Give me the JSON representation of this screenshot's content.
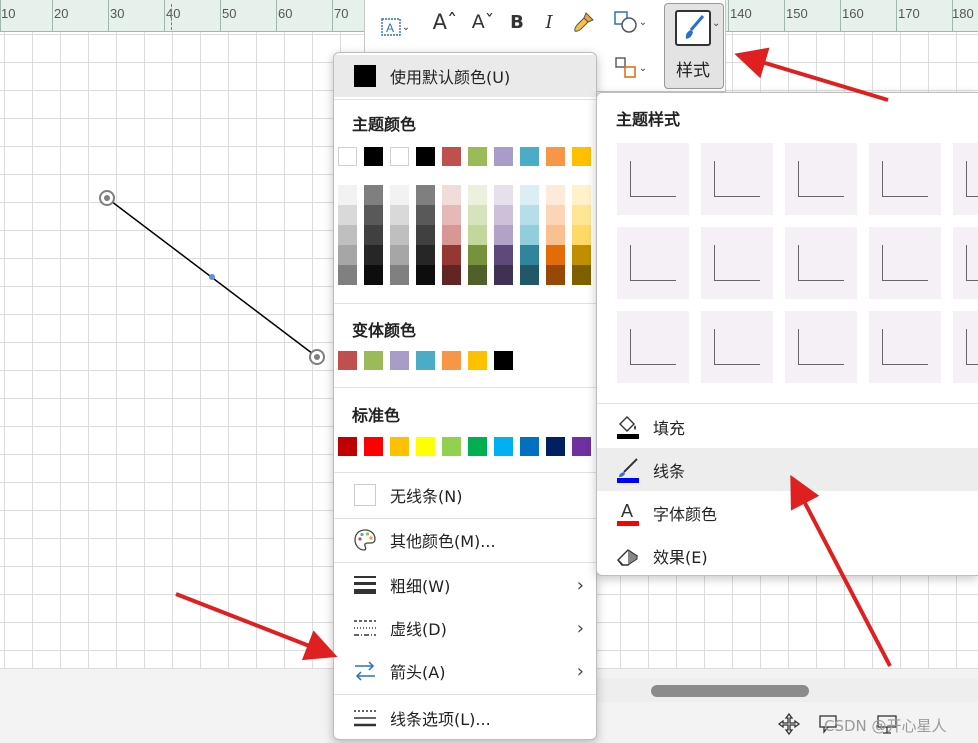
{
  "ruler": {
    "labels": [
      "10",
      "20",
      "30",
      "40",
      "50",
      "60",
      "70",
      "140",
      "150",
      "160",
      "170",
      "180"
    ]
  },
  "toolbar": {
    "style_label": "样式"
  },
  "color_menu": {
    "default_color_label": "使用默认颜色(U)",
    "theme_colors_title": "主题颜色",
    "theme_colors_top": [
      "#ffffff",
      "#000000",
      "#ffffff",
      "#000000",
      "#c0504d",
      "#9bbb59",
      "#a89cc8",
      "#4bacc6",
      "#f79646",
      "#ffc000"
    ],
    "theme_colors_shades": [
      [
        "#f2f2f2",
        "#d9d9d9",
        "#bfbfbf",
        "#a6a6a6",
        "#808080"
      ],
      [
        "#7f7f7f",
        "#595959",
        "#404040",
        "#262626",
        "#0d0d0d"
      ],
      [
        "#f2f2f2",
        "#d9d9d9",
        "#bfbfbf",
        "#a6a6a6",
        "#808080"
      ],
      [
        "#7f7f7f",
        "#595959",
        "#404040",
        "#262626",
        "#0d0d0d"
      ],
      [
        "#f2dcdb",
        "#e6b9b8",
        "#d99694",
        "#953734",
        "#632523"
      ],
      [
        "#ebf1dd",
        "#d7e3bc",
        "#c3d69b",
        "#76923c",
        "#4f6128"
      ],
      [
        "#e5e0ec",
        "#ccc1d9",
        "#b2a2c7",
        "#5f497a",
        "#3f3151"
      ],
      [
        "#dbeef3",
        "#b7dde8",
        "#92cddc",
        "#31859b",
        "#205867"
      ],
      [
        "#fdeada",
        "#fbd5b5",
        "#fac08f",
        "#e36c09",
        "#974806"
      ],
      [
        "#fff2ca",
        "#ffe694",
        "#ffd965",
        "#bf8f00",
        "#7f6000"
      ]
    ],
    "variant_colors_title": "变体颜色",
    "variant_colors": [
      "#c0504d",
      "#9bbb59",
      "#a89cc8",
      "#4bacc6",
      "#f79646",
      "#ffc000",
      "#000000"
    ],
    "standard_colors_title": "标准色",
    "standard_colors": [
      "#c00000",
      "#ff0000",
      "#ffc000",
      "#ffff00",
      "#92d050",
      "#00b050",
      "#00b0f0",
      "#0070c0",
      "#002060",
      "#7030a0"
    ],
    "no_line_label": "无线条(N)",
    "more_colors_label": "其他颜色(M)...",
    "weight_label": "粗细(W)",
    "dash_label": "虚线(D)",
    "arrow_label": "箭头(A)",
    "line_options_label": "线条选项(L)..."
  },
  "style_panel": {
    "title": "主题样式",
    "fill_label": "填充",
    "line_label": "线条",
    "font_color_label": "字体颜色",
    "effect_label": "效果(E)"
  },
  "watermark": "CSDN @开心星人",
  "colors": {
    "annotation_arrow": "#e02020",
    "handle_accent": "#5b8def"
  }
}
